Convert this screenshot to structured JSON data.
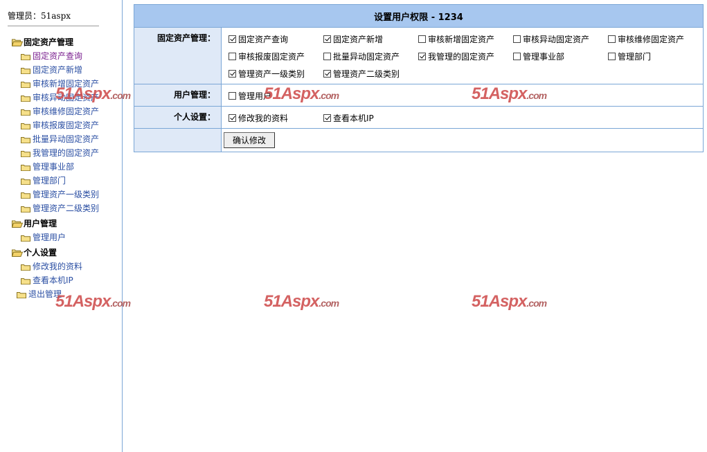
{
  "sidebar": {
    "admin_label": "管理员：51aspx",
    "groups": [
      {
        "label": "固定资产管理",
        "items": [
          "固定资产查询",
          "固定资产新增",
          "审核新增固定资产",
          "审核异动固定资产",
          "审核维修固定资产",
          "审核报废固定资产",
          "批量异动固定资产",
          "我管理的固定资产",
          "管理事业部",
          "管理部门",
          "管理资产一级类别",
          "管理资产二级类别"
        ]
      },
      {
        "label": "用户管理",
        "items": [
          "管理用户"
        ]
      },
      {
        "label": "个人设置",
        "items": [
          "修改我的资料",
          "查看本机IP"
        ]
      }
    ],
    "logout": "退出管理"
  },
  "main": {
    "title": "设置用户权限  - 1234",
    "sections": [
      {
        "label": "固定资产管理：",
        "options": [
          {
            "label": "固定资产查询",
            "checked": true
          },
          {
            "label": "固定资产新增",
            "checked": true
          },
          {
            "label": "审核新增固定资产",
            "checked": false
          },
          {
            "label": "审核异动固定资产",
            "checked": false
          },
          {
            "label": "审核维修固定资产",
            "checked": false
          },
          {
            "label": "审核报废固定资产",
            "checked": false
          },
          {
            "label": "批量异动固定资产",
            "checked": false
          },
          {
            "label": "我管理的固定资产",
            "checked": true
          },
          {
            "label": "管理事业部",
            "checked": false
          },
          {
            "label": "管理部门",
            "checked": false
          },
          {
            "label": "管理资产一级类别",
            "checked": true
          },
          {
            "label": "管理资产二级类别",
            "checked": true
          }
        ]
      },
      {
        "label": "用户管理：",
        "options": [
          {
            "label": "管理用户",
            "checked": false
          }
        ]
      },
      {
        "label": "个人设置：",
        "options": [
          {
            "label": "修改我的资料",
            "checked": true
          },
          {
            "label": "查看本机IP",
            "checked": true
          }
        ]
      }
    ],
    "submit_label": "确认修改"
  },
  "watermark": {
    "text": "51Aspx",
    "suffix": ".com"
  },
  "colors": {
    "title_bg": "#a7c7ef",
    "label_bg": "#dfe9f7",
    "border": "#7aa6d6",
    "link": "#2b4fa3"
  }
}
